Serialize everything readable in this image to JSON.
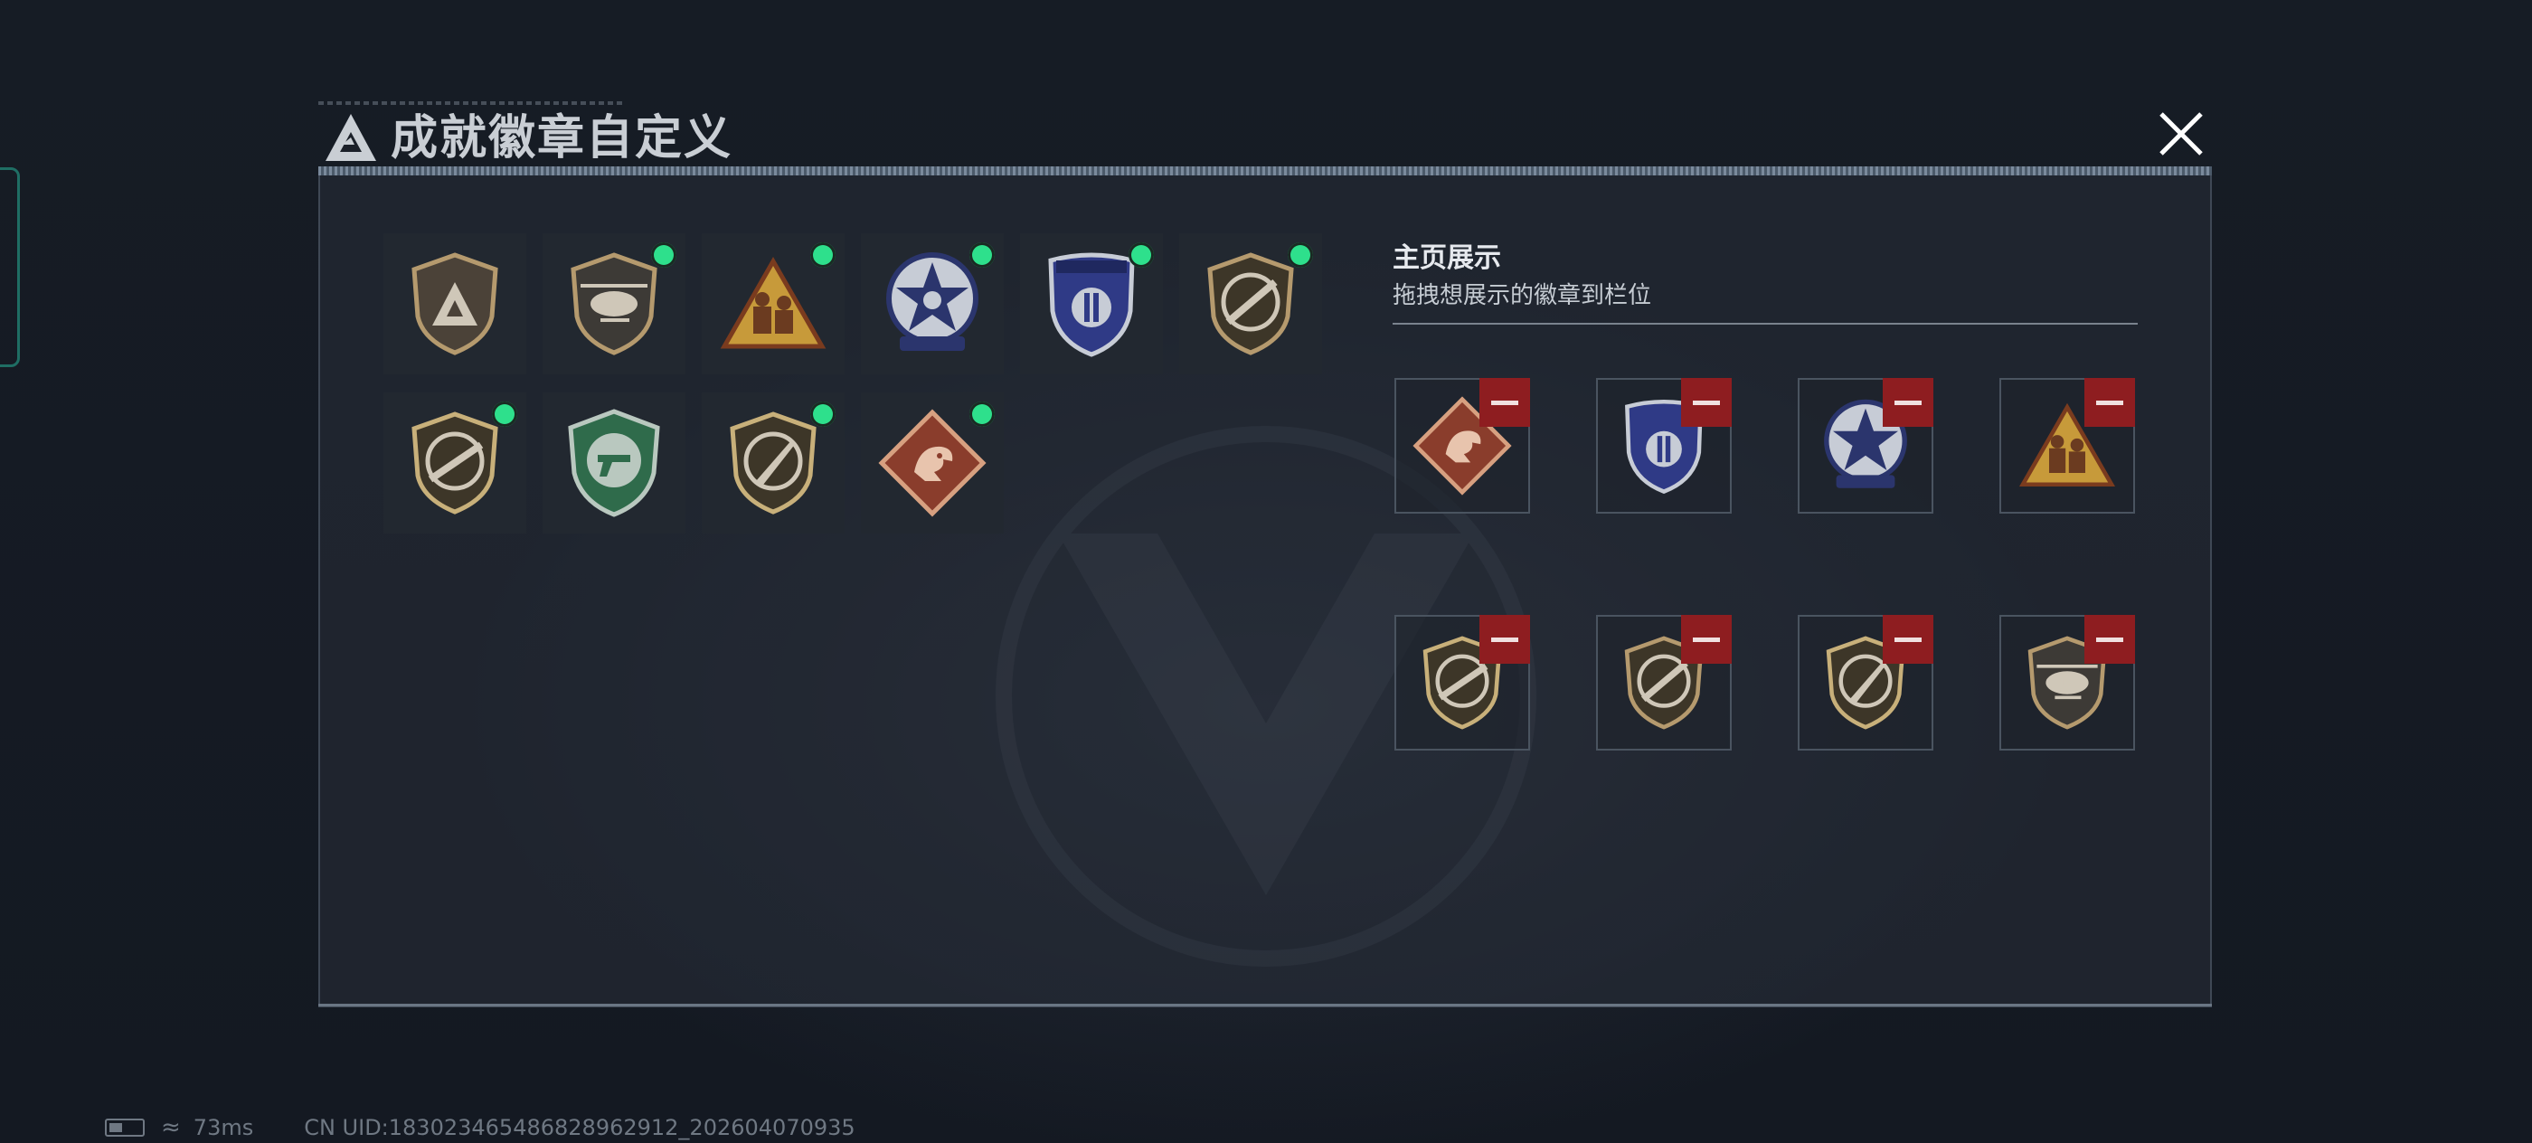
{
  "window": {
    "title": "成就徽章自定义",
    "close_icon": "close-icon"
  },
  "inventory": {
    "badges": [
      {
        "icon": "triangle-logo-shield-badge",
        "equipped": false
      },
      {
        "icon": "helicopter-shield-badge",
        "equipped": true
      },
      {
        "icon": "soldiers-triangle-badge",
        "equipped": true
      },
      {
        "icon": "star-blue-badge",
        "equipped": true
      },
      {
        "icon": "police-blue-shield-badge",
        "equipped": true
      },
      {
        "icon": "rifle-shield-badge",
        "equipped": true
      },
      {
        "icon": "rifle-round-shield-badge",
        "equipped": true
      },
      {
        "icon": "pistol-green-badge",
        "equipped": false
      },
      {
        "icon": "knife-shield-badge",
        "equipped": true
      },
      {
        "icon": "dragon-diamond-badge",
        "equipped": true
      }
    ]
  },
  "display": {
    "title": "主页展示",
    "subtitle": "拖拽想展示的徽章到栏位",
    "slots": [
      {
        "icon": "dragon-diamond-badge"
      },
      {
        "icon": "police-blue-shield-badge"
      },
      {
        "icon": "star-blue-badge"
      },
      {
        "icon": "soldiers-triangle-badge"
      },
      {
        "icon": "rifle-round-shield-badge"
      },
      {
        "icon": "rifle-shield-badge"
      },
      {
        "icon": "knife-shield-badge"
      },
      {
        "icon": "helicopter-shield-badge"
      }
    ],
    "remove_icon": "minus-icon"
  },
  "status_bar": {
    "latency": "73ms",
    "uid": "CN UID:18302346548682896291​2_202604070935"
  },
  "colors": {
    "equipped_dot": "#2ee08c",
    "remove_button": "#8e1d20",
    "panel_border": "#3f4855"
  }
}
